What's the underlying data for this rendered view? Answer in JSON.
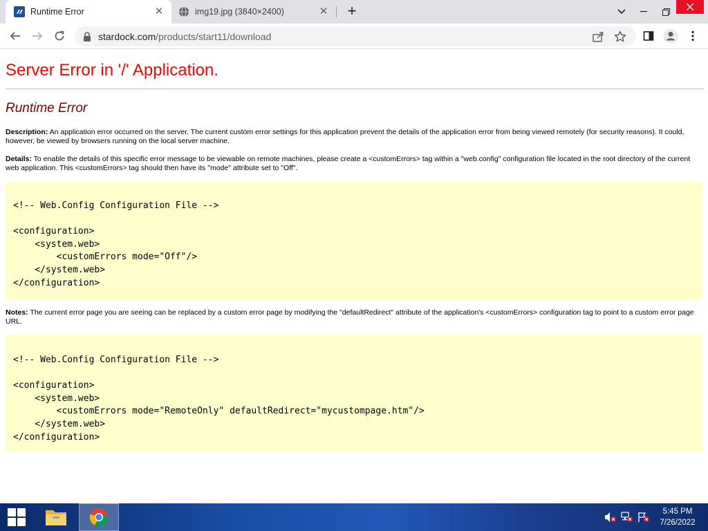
{
  "browser": {
    "tabs": [
      {
        "title": "Runtime Error",
        "active": true,
        "favicon": "stardock-icon"
      },
      {
        "title": "img19.jpg (3840×2400)",
        "active": false,
        "favicon": "globe-icon"
      }
    ],
    "address": {
      "host": "stardock.com",
      "path": "/products/start11/download"
    }
  },
  "page": {
    "heading": "Server Error in '/' Application.",
    "subheading": "Runtime Error",
    "description_label": "Description:",
    "description_text": " An application error occurred on the server. The current custom error settings for this application prevent the details of the application error from being viewed remotely (for security reasons). It could, however, be viewed by browsers running on the local server machine.",
    "details_label": "Details:",
    "details_text": " To enable the details of this specific error message to be viewable on remote machines, please create a <customErrors> tag within a \"web.config\" configuration file located in the root directory of the current web application. This <customErrors> tag should then have its \"mode\" attribute set to \"Off\".",
    "code1": "<!-- Web.Config Configuration File -->\n\n<configuration>\n    <system.web>\n        <customErrors mode=\"Off\"/>\n    </system.web>\n</configuration>",
    "notes_label": "Notes:",
    "notes_text": " The current error page you are seeing can be replaced by a custom error page by modifying the \"defaultRedirect\" attribute of the application's <customErrors> configuration tag to point to a custom error page URL.",
    "code2": "<!-- Web.Config Configuration File -->\n\n<configuration>\n    <system.web>\n        <customErrors mode=\"RemoteOnly\" defaultRedirect=\"mycustompage.htm\"/>\n    </system.web>\n</configuration>"
  },
  "taskbar": {
    "time": "5:45 PM",
    "date": "7/26/2022"
  },
  "colors": {
    "heading": "#ff0000",
    "subheading": "#800000",
    "code_background": "#ffffcc",
    "close_button": "#e81123"
  }
}
